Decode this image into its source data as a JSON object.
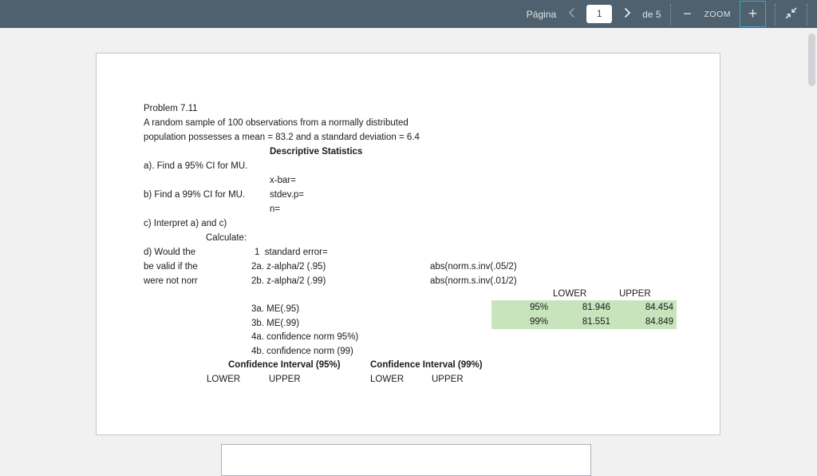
{
  "toolbar": {
    "page_label": "Página",
    "page_value": "1",
    "page_count_label": "de 5",
    "zoom_out_glyph": "−",
    "zoom_label": "ZOOM",
    "zoom_in_glyph": "+",
    "accent_color": "#4a9fd0"
  },
  "doc": {
    "title": "Problem 7.11",
    "intro_line1": "A random sample of 100 observations from a normally distributed",
    "intro_line2": "population possesses a mean = 83.2 and a standard deviation = 6.4",
    "section_header": "Descriptive Statistics",
    "part_a": "a). Find a 95% CI for MU.",
    "part_b": "b) Find a 99% CI for MU.",
    "part_c": "c) Interpret a) and c)",
    "part_d_line1": "d) Would the",
    "part_d_line2": "be valid if the",
    "part_d_line3": "were not norr",
    "xbar_label": "x-bar=",
    "stdev_label": "stdev.p=",
    "n_label": "n=",
    "calculate_label": "Calculate:",
    "step_1": "1  standard error=",
    "step_2a": "2a. z-alpha/2 (.95)",
    "step_2b": "2b. z-alpha/2 (.99)",
    "step_3a": "3a. ME(.95)",
    "step_3b": "3b. ME(.99)",
    "step_4a": "4a. confidence norm 95%)",
    "step_4b": "4b. confidence norm (99)",
    "formula_2a": "abs(norm.s.inv(.05/2)",
    "formula_2b": "abs(norm.s.inv(.01/2)",
    "results": {
      "highlight_color": "#c7e4bd",
      "col_headers": [
        "LOWER",
        "UPPER"
      ],
      "rows": [
        {
          "level": "95%",
          "lower": "81.946",
          "upper": "84.454"
        },
        {
          "level": "99%",
          "lower": "81.551",
          "upper": "84.849"
        }
      ]
    },
    "ci95_header": "Confidence Interval (95%)",
    "ci99_header": "Confidence Interval (99%)",
    "ci95_cols": [
      "LOWER",
      "UPPER"
    ],
    "ci99_cols": [
      "LOWER",
      "UPPER"
    ]
  }
}
